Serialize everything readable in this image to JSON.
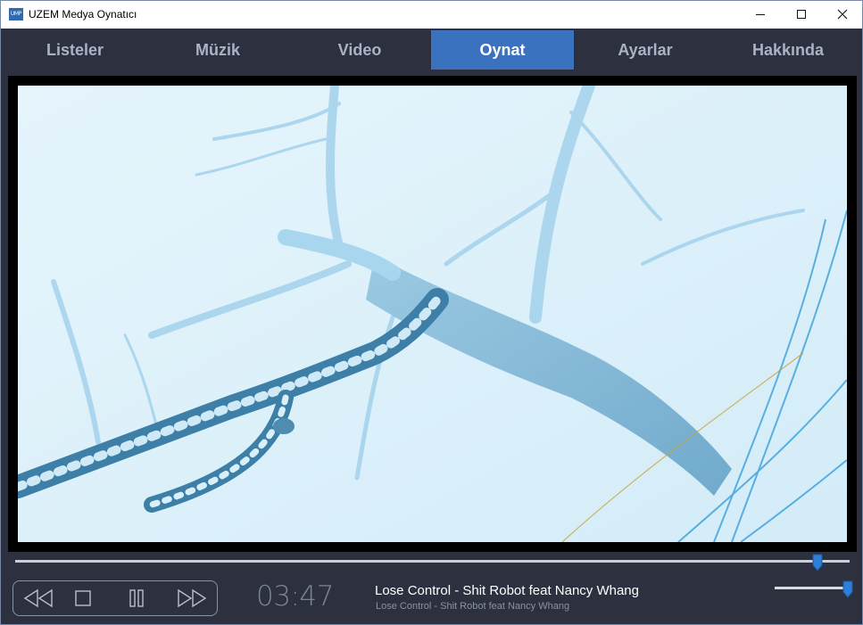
{
  "window": {
    "title": "UZEM Medya Oynatıcı",
    "icon_text": "UMP",
    "minimize": "minimize",
    "maximize": "maximize",
    "close": "close"
  },
  "nav": {
    "tabs": [
      {
        "label": "Listeler",
        "active": false
      },
      {
        "label": "Müzik",
        "active": false
      },
      {
        "label": "Video",
        "active": false
      },
      {
        "label": "Oynat",
        "active": true
      },
      {
        "label": "Ayarlar",
        "active": false
      },
      {
        "label": "Hakkında",
        "active": false
      }
    ]
  },
  "player": {
    "seek_fraction": 0.962,
    "volume_fraction": 0.95,
    "time": "03:47",
    "track_title": "Lose Control - Shit Robot feat Nancy Whang",
    "track_subtitle": "Lose Control - Shit Robot feat Nancy Whang",
    "controls": [
      "rewind-icon",
      "stop-icon",
      "pause-icon",
      "fast-forward-icon"
    ]
  },
  "colors": {
    "accent": "#3a72bf",
    "background": "#2c303f",
    "thumb": "#2e7fd8"
  }
}
